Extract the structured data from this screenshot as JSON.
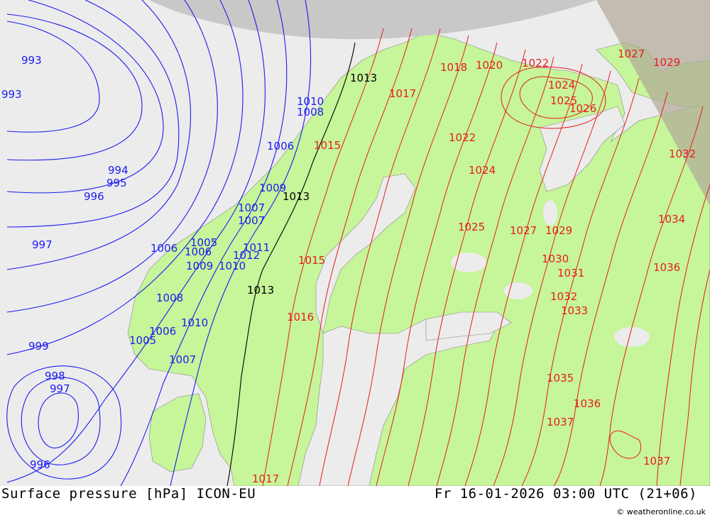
{
  "footer": {
    "title": "Surface pressure [hPa] ICON-EU",
    "datetime": "Fr 16-01-2026 03:00 UTC (21+06)",
    "credit": "© weatheronline.co.uk"
  },
  "colors": {
    "sea": "#ececec",
    "land": "#c6f59a",
    "low_isobar": "#1c1cf0",
    "high_isobar": "#e81c1c",
    "ref_isobar": "#000000",
    "polar_cap": "#c8c8c8",
    "shade": "#b0b0a0"
  },
  "isobar_labels": {
    "low": [
      "993",
      "993",
      "994",
      "995",
      "996",
      "997",
      "999",
      "998",
      "997",
      "996",
      "1006",
      "1007",
      "1009",
      "1010",
      "1008",
      "1006",
      "1005",
      "1007",
      "1009",
      "1010",
      "1008",
      "1006",
      "1010",
      "1007",
      "1012",
      "1011",
      "1005",
      "1006"
    ],
    "high": [
      "1015",
      "1017",
      "1018",
      "1020",
      "1022",
      "1024",
      "1025",
      "1026",
      "1027",
      "1029",
      "1030",
      "1031",
      "1032",
      "1033",
      "1034",
      "1035",
      "1036",
      "1037",
      "1022",
      "1024",
      "1025",
      "1027",
      "1029",
      "1030",
      "1031",
      "1032",
      "1033",
      "1035",
      "1036",
      "1037",
      "1037",
      "1036",
      "1032",
      "1029",
      "1027",
      "1016",
      "1015",
      "1017"
    ],
    "reference": [
      "1013",
      "1013",
      "1013"
    ]
  }
}
